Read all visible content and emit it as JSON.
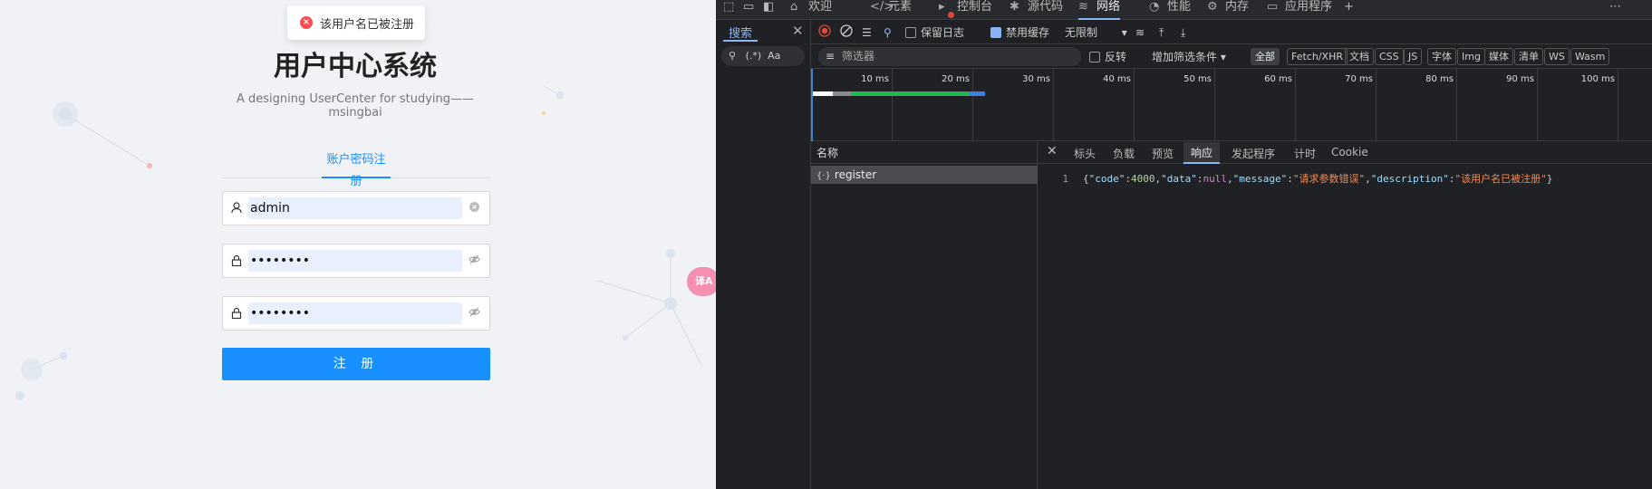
{
  "toast": {
    "message": "该用户名已被注册",
    "icon": "error-icon",
    "color": "#ff4d4f"
  },
  "page": {
    "title": "用户中心系统",
    "subtitle": "A designing UserCenter for studying——msingbai",
    "tab": "账户密码注册",
    "fields": {
      "username": {
        "value": "admin",
        "icon": "user-icon"
      },
      "password": {
        "value": "••••••••",
        "icon": "lock-icon"
      },
      "check_password": {
        "value": "••••••••",
        "icon": "lock-icon"
      }
    },
    "register_button": "注 册",
    "translate_fab": "译A",
    "accent": "#1890ff"
  },
  "devtools": {
    "tabs": [
      "欢迎",
      "元素",
      "控制台",
      "源代码",
      "网络",
      "性能",
      "内存",
      "应用程序"
    ],
    "drawer": {
      "tab": "搜索",
      "search_option_regex": "(.*)",
      "search_option_case": "Aa"
    },
    "toolbar": {
      "preserve_log": "保留日志",
      "disable_cache": "禁用缓存",
      "throttle": "无限制"
    },
    "filter": {
      "placeholder": "筛选器",
      "invert": "反转",
      "more_filters": "增加筛选条件",
      "chips": [
        "全部",
        "Fetch/XHR",
        "文档",
        "CSS",
        "JS",
        "字体",
        "Img",
        "媒体",
        "清单",
        "WS",
        "Wasm"
      ]
    },
    "timeline_ticks": [
      "10 ms",
      "20 ms",
      "30 ms",
      "40 ms",
      "50 ms",
      "60 ms",
      "70 ms",
      "80 ms",
      "90 ms",
      "100 ms"
    ],
    "name_header": "名称",
    "request": {
      "name": "register",
      "icon": "xhr-icon"
    },
    "detail_tabs": [
      "标头",
      "负载",
      "预览",
      "响应",
      "发起程序",
      "计时",
      "Cookie"
    ],
    "response": {
      "line": "1",
      "code_key": "\"code\"",
      "code_val": "4000",
      "data_key": "\"data\"",
      "data_val": "null",
      "message_key": "\"message\"",
      "message_val": "\"请求参数错误\"",
      "desc_key": "\"description\"",
      "desc_val": "\"该用户名已被注册\""
    }
  }
}
